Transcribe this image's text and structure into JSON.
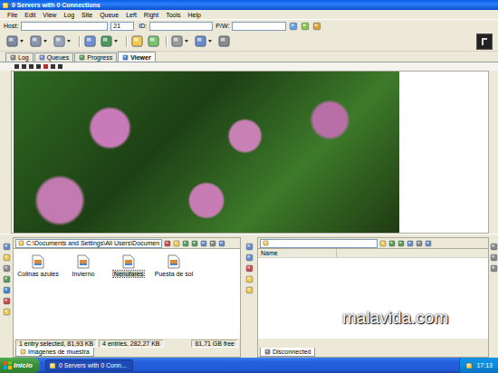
{
  "window": {
    "title": "0 Servers with 0 Connections"
  },
  "menu": [
    "File",
    "Edit",
    "View",
    "Log",
    "Site",
    "Queue",
    "Left",
    "Right",
    "Tools",
    "Help"
  ],
  "address_bar": {
    "host_label": "Host:",
    "port": "21",
    "id_label": "ID:",
    "pw_label": "P/W:"
  },
  "tabs": [
    {
      "label": "Log",
      "selected": false
    },
    {
      "label": "Queues",
      "selected": false
    },
    {
      "label": "Progress",
      "selected": false
    },
    {
      "label": "Viewer",
      "selected": true
    }
  ],
  "left_pane": {
    "path": "C:\\Documents and Settings\\All Users\\Documen",
    "files": [
      {
        "name": "Colinas azules",
        "selected": false
      },
      {
        "name": "Invierno",
        "selected": false
      },
      {
        "name": "Nenúfares",
        "selected": true
      },
      {
        "name": "Puesta de sol",
        "selected": false
      }
    ],
    "status": [
      "1 entry selected, 81,93 KB",
      "4 entries, 282,27 KB",
      "61,71 GB free"
    ],
    "tab": "Imágenes de muestra"
  },
  "right_pane": {
    "columns": [
      "Name"
    ],
    "tab": "Disconnected"
  },
  "watermark": "malavida.com",
  "taskbar": {
    "start": "Inicio",
    "tasks": [
      {
        "label": "0 Servers with 0 Conn...",
        "selected": true
      }
    ],
    "clock": "17:13"
  }
}
